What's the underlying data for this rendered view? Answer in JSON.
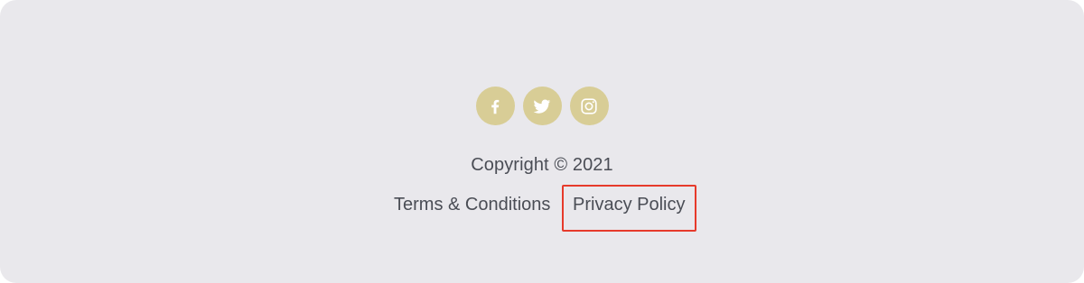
{
  "footer": {
    "social": [
      {
        "name": "facebook",
        "icon": "facebook-icon"
      },
      {
        "name": "twitter",
        "icon": "twitter-icon"
      },
      {
        "name": "instagram",
        "icon": "instagram-icon"
      }
    ],
    "copyright": "Copyright © 2021",
    "links": {
      "terms": "Terms & Conditions",
      "privacy": "Privacy Policy"
    }
  },
  "colors": {
    "background": "#e9e8ec",
    "social_circle": "#d8cd96",
    "text": "#4a4d55",
    "highlight": "#e63a2b"
  }
}
